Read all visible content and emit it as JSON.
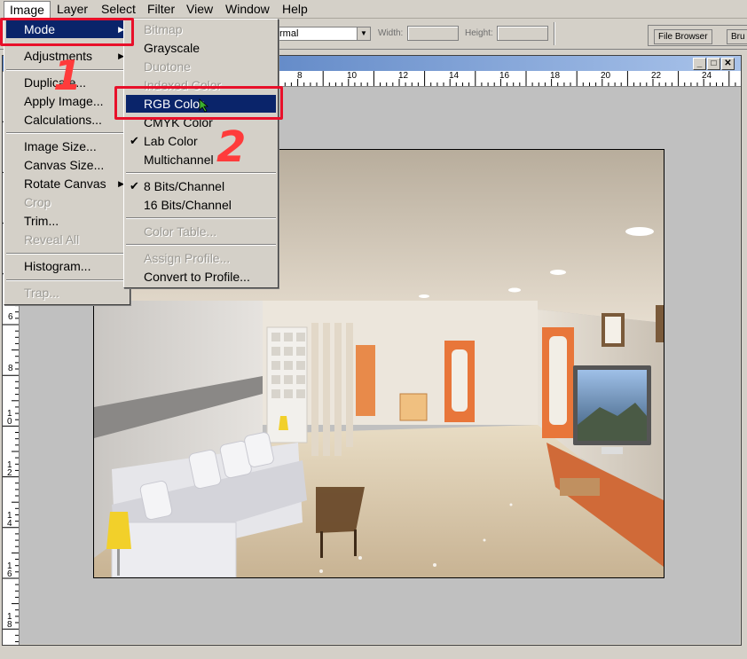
{
  "menubar": {
    "items": [
      "Image",
      "Layer",
      "Select",
      "Filter",
      "View",
      "Window",
      "Help"
    ]
  },
  "options_bar": {
    "style_value": "rmal",
    "width_label": "Width:",
    "height_label": "Height:",
    "tabs": [
      "File Browser",
      "Bru"
    ]
  },
  "image_menu": {
    "items": [
      {
        "label": "Mode",
        "submenu": true
      },
      {
        "label": "Adjustments",
        "submenu": true
      },
      {
        "label": "Duplicate..."
      },
      {
        "label": "Apply Image..."
      },
      {
        "label": "Calculations..."
      },
      {
        "label": "Image Size..."
      },
      {
        "label": "Canvas Size..."
      },
      {
        "label": "Rotate Canvas",
        "submenu": true
      },
      {
        "label": "Crop",
        "disabled": true
      },
      {
        "label": "Trim..."
      },
      {
        "label": "Reveal All",
        "disabled": true
      },
      {
        "label": "Histogram..."
      },
      {
        "label": "Trap...",
        "disabled": true
      }
    ]
  },
  "mode_menu": {
    "items": [
      {
        "label": "Bitmap",
        "disabled": true
      },
      {
        "label": "Grayscale"
      },
      {
        "label": "Duotone",
        "disabled": true
      },
      {
        "label": "Indexed Color",
        "disabled": true
      },
      {
        "label": "RGB Color",
        "highlighted": true
      },
      {
        "label": "CMYK Color"
      },
      {
        "label": "Lab Color",
        "checked": true
      },
      {
        "label": "Multichannel"
      },
      {
        "label": "8 Bits/Channel",
        "checked": true
      },
      {
        "label": "16 Bits/Channel"
      },
      {
        "label": "Color Table...",
        "disabled": true
      },
      {
        "label": "Assign Profile...",
        "disabled": true
      },
      {
        "label": "Convert to Profile..."
      }
    ]
  },
  "rulers": {
    "horizontal": [
      "8",
      "10",
      "12",
      "14",
      "16",
      "18",
      "20",
      "22",
      "24"
    ],
    "vertical": [
      "6",
      "8",
      "1 0",
      "1 2",
      "1 4",
      "1 6",
      "1 8"
    ]
  },
  "annotations": {
    "step1": "1",
    "step2": "2"
  },
  "colors": {
    "highlight": "#0a246a",
    "annotation_red": "#e8102a",
    "menu_bg": "#d4d0c8"
  }
}
